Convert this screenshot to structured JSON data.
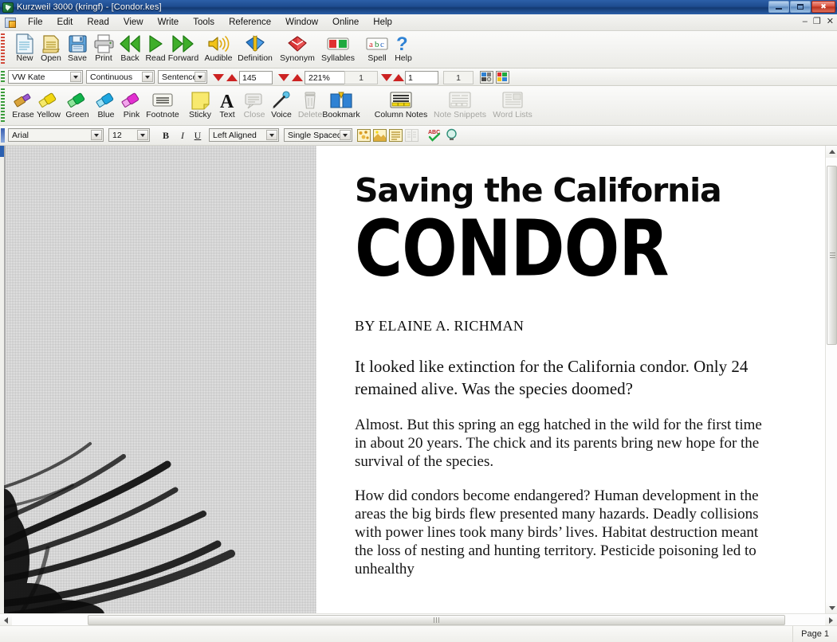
{
  "window": {
    "title": "Kurzweil 3000 (kringf) - [Condor.kes]",
    "app_icon": "kurzweil-logo-icon",
    "buttons": {
      "minimize": "minimize-icon",
      "restore": "restore-icon",
      "close": "close-icon"
    },
    "mdi_buttons": {
      "minimize": "–",
      "restore": "❐",
      "close": "✕"
    }
  },
  "menubar": {
    "doc_icon": "document-icon",
    "items": [
      {
        "label": "File"
      },
      {
        "label": "Edit"
      },
      {
        "label": "Read"
      },
      {
        "label": "View"
      },
      {
        "label": "Write"
      },
      {
        "label": "Tools"
      },
      {
        "label": "Reference"
      },
      {
        "label": "Window"
      },
      {
        "label": "Online"
      },
      {
        "label": "Help"
      }
    ]
  },
  "main_toolbar": {
    "items": [
      {
        "label": "New",
        "icon": "new-document-icon",
        "enabled": true
      },
      {
        "label": "Open",
        "icon": "open-folder-icon",
        "enabled": true
      },
      {
        "label": "Save",
        "icon": "floppy-disk-icon",
        "enabled": true
      },
      {
        "label": "Print",
        "icon": "printer-icon",
        "enabled": true
      },
      {
        "label": "Back",
        "icon": "rewind-icon",
        "enabled": true
      },
      {
        "label": "Read",
        "icon": "play-icon",
        "enabled": true
      },
      {
        "label": "Forward",
        "icon": "fast-forward-icon",
        "enabled": true
      },
      {
        "label": "Audible",
        "icon": "speaker-icon",
        "enabled": true
      },
      {
        "label": "Definition",
        "icon": "dictionary-icon",
        "enabled": true
      },
      {
        "label": "Synonym",
        "icon": "thesaurus-icon",
        "enabled": true
      },
      {
        "label": "Syllables",
        "icon": "syllables-icon",
        "enabled": true
      },
      {
        "label": "Spell",
        "icon": "abc-spell-icon",
        "enabled": true
      },
      {
        "label": "Help",
        "icon": "question-mark-icon",
        "enabled": true
      }
    ]
  },
  "reading_toolbar": {
    "voice": {
      "value": "VW Kate",
      "label": "voice-select"
    },
    "reading_mode": {
      "value": "Continuous"
    },
    "reading_unit": {
      "value": "Sentence"
    },
    "speed": {
      "value": "145",
      "down_icon": "spin-down-icon",
      "up_icon": "spin-up-icon"
    },
    "zoom": {
      "value": "221%",
      "down_icon": "spin-down-icon",
      "up_icon": "spin-up-icon"
    },
    "page_total": {
      "value": "1"
    },
    "page_current": {
      "value": "1"
    },
    "page_end": {
      "value": "1"
    },
    "right_icons": [
      {
        "icon": "dual-page-view-icon"
      },
      {
        "icon": "thumbnail-view-icon"
      }
    ]
  },
  "markup_toolbar": {
    "items": [
      {
        "label": "Erase",
        "icon": "eraser-highlighter-icon",
        "enabled": true
      },
      {
        "label": "Yellow",
        "icon": "yellow-highlighter-icon",
        "enabled": true
      },
      {
        "label": "Green",
        "icon": "green-highlighter-icon",
        "enabled": true
      },
      {
        "label": "Blue",
        "icon": "blue-highlighter-icon",
        "enabled": true
      },
      {
        "label": "Pink",
        "icon": "pink-highlighter-icon",
        "enabled": true
      },
      {
        "label": "Footnote",
        "icon": "footnote-icon",
        "enabled": true
      },
      {
        "label": "Sticky",
        "icon": "sticky-note-icon",
        "enabled": true
      },
      {
        "label": "Text",
        "icon": "text-note-icon",
        "enabled": true
      },
      {
        "label": "Close",
        "icon": "close-note-icon",
        "enabled": false
      },
      {
        "label": "Voice",
        "icon": "microphone-icon",
        "enabled": true
      },
      {
        "label": "Delete",
        "icon": "trash-can-icon",
        "enabled": false
      },
      {
        "label": "Bookmark",
        "icon": "open-book-bookmark-icon",
        "enabled": true
      },
      {
        "label": "Column Notes",
        "icon": "column-notes-icon",
        "enabled": true
      },
      {
        "label": "Note Snippets",
        "icon": "note-snippets-icon",
        "enabled": false
      },
      {
        "label": "Word Lists",
        "icon": "word-lists-icon",
        "enabled": false
      }
    ]
  },
  "format_toolbar": {
    "font": {
      "value": "Arial"
    },
    "size": {
      "value": "12"
    },
    "bold": {
      "label": "B",
      "icon": "bold-icon"
    },
    "italic": {
      "label": "I",
      "icon": "italic-icon"
    },
    "underline": {
      "label": "U",
      "icon": "underline-icon"
    },
    "alignment": {
      "value": "Left Aligned"
    },
    "spacing": {
      "value": "Single Spaced"
    },
    "icons": [
      {
        "icon": "image-fill-icon"
      },
      {
        "icon": "page-layout-icon"
      },
      {
        "icon": "text-lines-icon"
      },
      {
        "icon": "columns-icon"
      }
    ],
    "spell_check": {
      "icon": "spell-check-abc-icon"
    },
    "magnify": {
      "icon": "magnifier-icon"
    }
  },
  "document": {
    "image_alt": "condor-feather-photograph",
    "kicker": "Saving the California",
    "headline": "CONDOR",
    "byline": "BY ELAINE A. RICHMAN",
    "deck": "It looked like extinction for the California condor. Only 24 remained alive. Was the species doomed?",
    "paragraphs": [
      "Almost. But this spring an egg hatched in the wild for the first time in about 20 years. The chick and its parents bring new hope for the survival of the species.",
      "How did condors become endangered? Human development in the areas the big birds flew presented many hazards. Deadly collisions with power lines took many birds’ lives. Habitat destruction meant the loss of nesting and hunting territory. Pesticide poisoning led to unhealthy"
    ]
  },
  "scrollbars": {
    "vertical": {
      "up_icon": "scroll-up-arrow-icon",
      "down_icon": "scroll-down-arrow-icon",
      "thumb": "vertical-scroll-thumb"
    },
    "horizontal": {
      "left_icon": "scroll-left-arrow-icon",
      "right_icon": "scroll-right-arrow-icon",
      "thumb": "horizontal-scroll-thumb"
    }
  },
  "statusbar": {
    "page": "Page 1"
  },
  "colors": {
    "titlebar": "#1e4c8f",
    "accent_red": "#cc2222",
    "toolbar_bg": "#efefeb",
    "highlight_yellow": "#f2d712",
    "highlight_green": "#11b34a",
    "highlight_blue": "#1ea6e0",
    "highlight_pink": "#e22fd0"
  }
}
